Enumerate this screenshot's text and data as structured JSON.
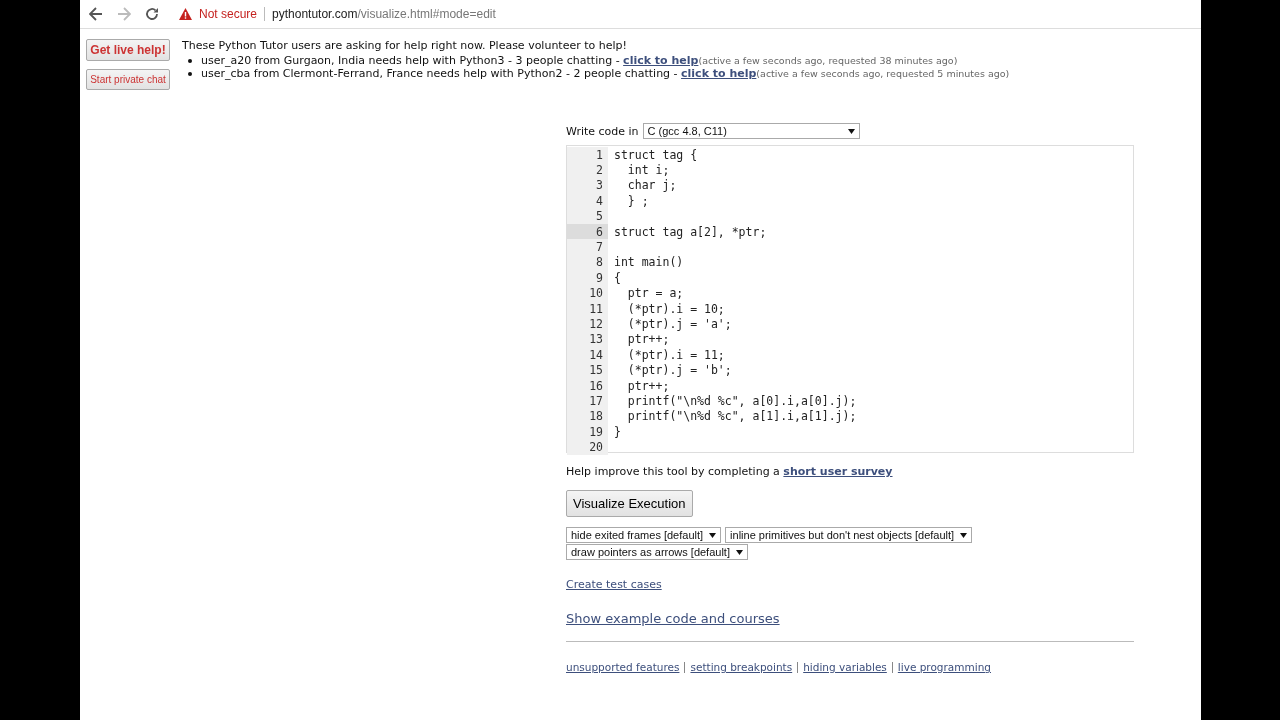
{
  "browser": {
    "security": "Not secure",
    "url_host": "pythontutor.com",
    "url_path": "/visualize.html#mode=edit"
  },
  "help_panel": {
    "live_help_button": "Get live help!",
    "private_chat_button": "Start private chat",
    "heading": "These Python Tutor users are asking for help right now. Please volunteer to help!",
    "requests": [
      {
        "text": "user_a20 from Gurgaon, India needs help with Python3 - 3 people chatting - ",
        "link": "click to help",
        "note": "(active a few seconds ago, requested 38 minutes ago)"
      },
      {
        "text": "user_cba from Clermont-Ferrand, France needs help with Python2 - 2 people chatting - ",
        "link": "click to help",
        "note": "(active a few seconds ago, requested 5 minutes ago)"
      }
    ]
  },
  "editor": {
    "language_label": "Write code in",
    "language": "C (gcc 4.8, C11)",
    "lines": [
      {
        "number": "1",
        "code": "struct tag {",
        "selected": false
      },
      {
        "number": "2",
        "code": "  int i;",
        "selected": false
      },
      {
        "number": "3",
        "code": "  char j;",
        "selected": false
      },
      {
        "number": "4",
        "code": "  } ;",
        "selected": false
      },
      {
        "number": "5",
        "selected": false
      },
      {
        "number": "6",
        "code": "struct tag a[2], *ptr;",
        "selected": true
      },
      {
        "number": "7",
        "selected": false
      },
      {
        "number": "8",
        "code": "int main()",
        "selected": false
      },
      {
        "number": "9",
        "code": "{",
        "selected": false
      },
      {
        "number": "10",
        "code": "  ptr = a;",
        "selected": false
      },
      {
        "number": "11",
        "code": "  (*ptr).i = 10;",
        "selected": false
      },
      {
        "number": "12",
        "code": "  (*ptr).j = 'a';",
        "selected": false
      },
      {
        "number": "13",
        "code": "  ptr++;",
        "selected": false
      },
      {
        "number": "14",
        "code": "  (*ptr).i = 11;",
        "selected": false
      },
      {
        "number": "15",
        "code": "  (*ptr).j = 'b';",
        "selected": false
      },
      {
        "number": "16",
        "code": "  ptr++;",
        "selected": false
      },
      {
        "number": "17",
        "code": "  printf(\"\\n%d %c\", a[0].i,a[0].j);",
        "selected": false
      },
      {
        "number": "18",
        "code": "  printf(\"\\n%d %c\", a[1].i,a[1].j);",
        "selected": false
      },
      {
        "number": "19",
        "code": "}",
        "selected": false
      },
      {
        "number": "20",
        "selected": false
      }
    ]
  },
  "survey": {
    "text": "Help improve this tool by completing a ",
    "link": "short user survey"
  },
  "visualize_button": "Visualize Execution",
  "options": [
    "hide exited frames [default]",
    "inline primitives but don't nest objects [default]",
    "draw pointers as arrows [default]"
  ],
  "create_test_cases": "Create test cases",
  "show_examples": "Show example code and courses",
  "footer_links": [
    "unsupported features",
    "setting breakpoints",
    "hiding variables",
    "live programming"
  ]
}
